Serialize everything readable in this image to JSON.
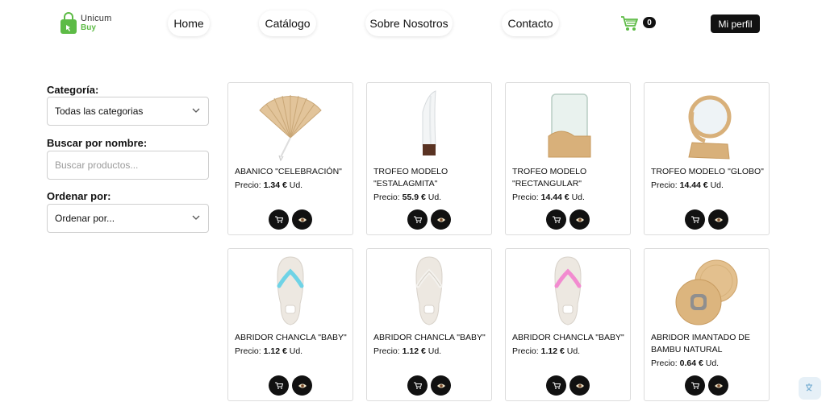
{
  "brand": {
    "line1": "Unicum",
    "line2": "Buy",
    "color": "#5dbb46"
  },
  "nav": {
    "home": "Home",
    "catalog": "Catálogo",
    "about": "Sobre Nosotros",
    "contact": "Contacto",
    "cart_count": "0",
    "profile": "Mi perfil"
  },
  "filters": {
    "category_label": "Categoría:",
    "category_value": "Todas las categorias",
    "search_label": "Buscar por nombre:",
    "search_placeholder": "Buscar productos...",
    "sort_label": "Ordenar por:",
    "sort_value": "Ordenar por..."
  },
  "products": [
    {
      "name": "ABANICO \"CELEBRACIÓN\"",
      "price_prefix": "Precio: ",
      "price": "1.34 €",
      "unit": " Ud.",
      "icon": "fan"
    },
    {
      "name": "TROFEO MODELO \"ESTALAGMITA\"",
      "price_prefix": "Precio: ",
      "price": "55.9 €",
      "unit": " Ud.",
      "icon": "trophy-crystal"
    },
    {
      "name": "TROFEO MODELO \"RECTANGULAR\"",
      "price_prefix": "Precio: ",
      "price": "14.44 €",
      "unit": " Ud.",
      "icon": "trophy-rect"
    },
    {
      "name": "TROFEO MODELO \"GLOBO\"",
      "price_prefix": "Precio: ",
      "price": "14.44 €",
      "unit": " Ud.",
      "icon": "trophy-globe"
    },
    {
      "name": "ABRIDOR CHANCLA \"BABY\"",
      "price_prefix": "Precio: ",
      "price": "1.12 €",
      "unit": " Ud.",
      "icon": "flipflop-blue"
    },
    {
      "name": "ABRIDOR CHANCLA \"BABY\"",
      "price_prefix": "Precio: ",
      "price": "1.12 €",
      "unit": " Ud.",
      "icon": "flipflop-white"
    },
    {
      "name": "ABRIDOR CHANCLA \"BABY\"",
      "price_prefix": "Precio: ",
      "price": "1.12 €",
      "unit": " Ud.",
      "icon": "flipflop-pink"
    },
    {
      "name": "ABRIDOR IMANTADO DE BAMBU NATURAL",
      "price_prefix": "Precio: ",
      "price": "0.64 €",
      "unit": " Ud.",
      "icon": "bamboo-opener"
    }
  ]
}
